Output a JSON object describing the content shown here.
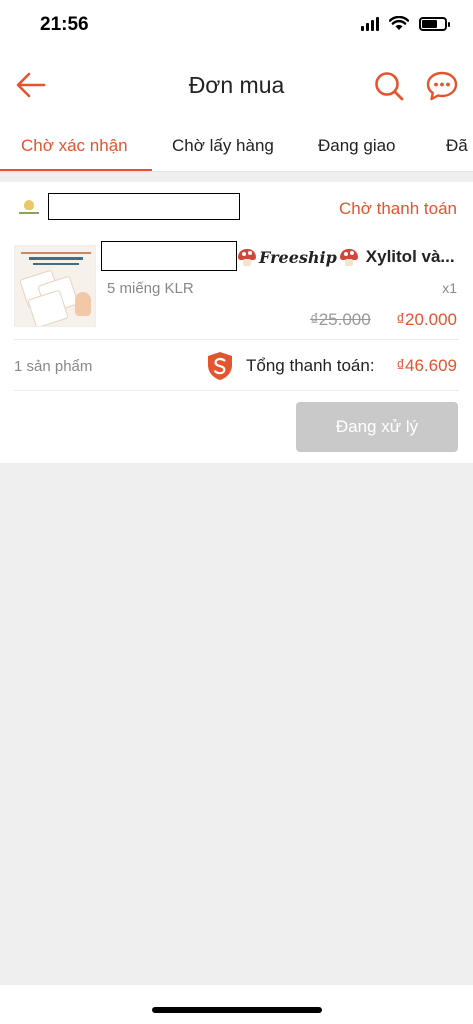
{
  "status_bar": {
    "time": "21:56",
    "icons": [
      "signal-icon",
      "wifi-icon",
      "battery-icon"
    ]
  },
  "header": {
    "title": "Đơn mua",
    "icons": [
      "back-arrow-icon",
      "search-icon",
      "chat-icon"
    ]
  },
  "tabs": [
    {
      "label": "Chờ xác nhận",
      "active": true
    },
    {
      "label": "Chờ lấy hàng",
      "active": false
    },
    {
      "label": "Đang giao",
      "active": false
    },
    {
      "label": "Đã",
      "active": false
    }
  ],
  "order": {
    "status": "Chờ thanh toán",
    "product": {
      "freeship_tag": "Freeship",
      "name": "Xylitol và...",
      "variant": "5 miếng KLR",
      "quantity": "x1",
      "original_price": "₫25.000",
      "price": "₫20.000"
    },
    "item_count": "1 sản phẩm",
    "total_label": "Tổng thanh toán:",
    "total_value": "₫46.609",
    "action_button": "Đang xử lý"
  },
  "colors": {
    "accent": "#e3542f",
    "disabled_button": "#c9c9c9",
    "background": "#efefef"
  }
}
